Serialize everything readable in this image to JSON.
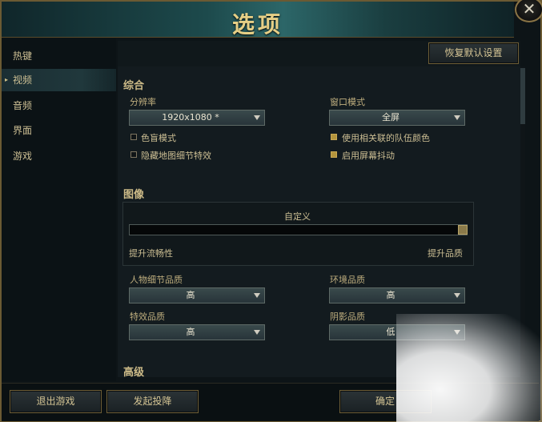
{
  "window": {
    "title": "选项",
    "close_glyph": "✕"
  },
  "sidebar": {
    "items": [
      {
        "label": "热键"
      },
      {
        "label": "视频",
        "active": true
      },
      {
        "label": "音频"
      },
      {
        "label": "界面"
      },
      {
        "label": "游戏"
      }
    ],
    "active_marker": "▸"
  },
  "top": {
    "restore_defaults": "恢复默认设置"
  },
  "general": {
    "title": "综合",
    "resolution_label": "分辨率",
    "resolution_value": "1920x1080 *",
    "window_mode_label": "窗口模式",
    "window_mode_value": "全屏",
    "checkboxes": [
      {
        "label": "色盲模式",
        "checked": false
      },
      {
        "label": "隐藏地图细节特效",
        "checked": false
      },
      {
        "label": "使用相关联的队伍颜色",
        "checked": true
      },
      {
        "label": "启用屏幕抖动",
        "checked": true
      }
    ]
  },
  "graphics": {
    "title": "图像",
    "preset_label": "自定义",
    "slider_level": 1.0,
    "left_hint": "提升流畅性",
    "right_hint": "提升品质",
    "character_quality_label": "人物细节品质",
    "character_quality_value": "高",
    "environment_quality_label": "环境品质",
    "environment_quality_value": "高",
    "effects_quality_label": "特效品质",
    "effects_quality_value": "高",
    "shadow_quality_label": "阴影品质",
    "shadow_quality_value": "低"
  },
  "advanced": {
    "title": "高级"
  },
  "footer": {
    "exit_game": "退出游戏",
    "surrender": "发起投降",
    "confirm": "确定"
  },
  "colors": {
    "gold": "#c9b98a",
    "check_on": "#b4953c",
    "dropdown": "#2f3d41"
  }
}
